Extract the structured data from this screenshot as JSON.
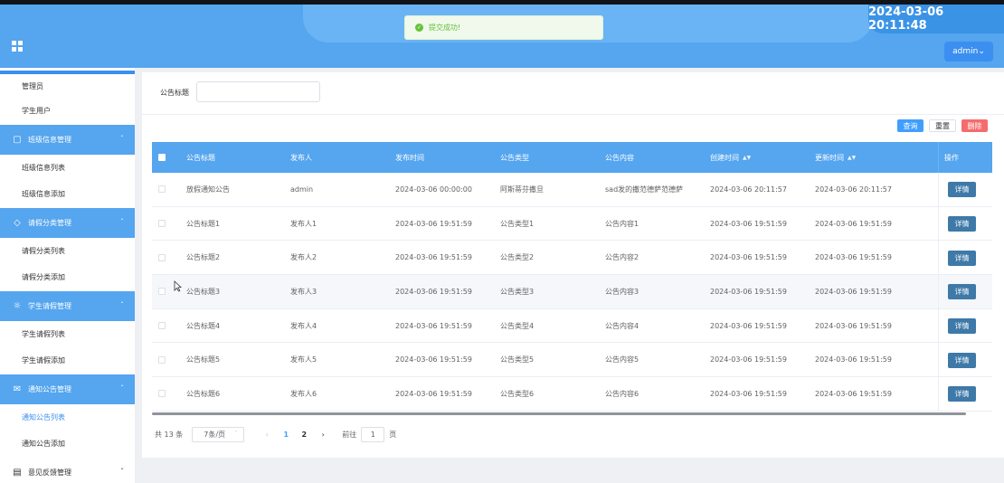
{
  "header": {
    "clock": "2024-03-06 20:11:48",
    "user_button": "admin⌄",
    "toast": "提交成功!"
  },
  "sidebar": {
    "top_items": [
      "管理员",
      "学生用户"
    ],
    "groups": [
      {
        "label": "班级信息管理",
        "icon": "bookmark-icon",
        "items": [
          "班级信息列表",
          "班级信息添加"
        ]
      },
      {
        "label": "请假分类管理",
        "icon": "tag-icon",
        "items": [
          "请假分类列表",
          "请假分类添加"
        ]
      },
      {
        "label": "学生请假管理",
        "icon": "gear-icon",
        "items": [
          "学生请假列表",
          "学生请假添加"
        ]
      },
      {
        "label": "通知公告管理",
        "icon": "mail-icon",
        "items": [
          "通知公告列表",
          "通知公告添加"
        ]
      }
    ],
    "collapsed_group": "意见反馈管理"
  },
  "search": {
    "label": "公告标题",
    "value": ""
  },
  "toolbar": {
    "query": "查询",
    "reset": "重置",
    "delete": "删除"
  },
  "table": {
    "headers": [
      "公告标题",
      "发布人",
      "发布时间",
      "公告类型",
      "公告内容",
      "创建时间",
      "更新时间",
      "操作"
    ],
    "rows": [
      [
        "放假通知公告",
        "admin",
        "2024-03-06 00:00:00",
        "阿斯蒂芬撒旦",
        "sad发的撒范德萨范德萨",
        "2024-03-06 20:11:57",
        "2024-03-06 20:11:57"
      ],
      [
        "公告标题1",
        "发布人1",
        "2024-03-06 19:51:59",
        "公告类型1",
        "公告内容1",
        "2024-03-06 19:51:59",
        "2024-03-06 19:51:59"
      ],
      [
        "公告标题2",
        "发布人2",
        "2024-03-06 19:51:59",
        "公告类型2",
        "公告内容2",
        "2024-03-06 19:51:59",
        "2024-03-06 19:51:59"
      ],
      [
        "公告标题3",
        "发布人3",
        "2024-03-06 19:51:59",
        "公告类型3",
        "公告内容3",
        "2024-03-06 19:51:59",
        "2024-03-06 19:51:59"
      ],
      [
        "公告标题4",
        "发布人4",
        "2024-03-06 19:51:59",
        "公告类型4",
        "公告内容4",
        "2024-03-06 19:51:59",
        "2024-03-06 19:51:59"
      ],
      [
        "公告标题5",
        "发布人5",
        "2024-03-06 19:51:59",
        "公告类型5",
        "公告内容5",
        "2024-03-06 19:51:59",
        "2024-03-06 19:51:59"
      ],
      [
        "公告标题6",
        "发布人6",
        "2024-03-06 19:51:59",
        "公告类型6",
        "公告内容6",
        "2024-03-06 19:51:59",
        "2024-03-06 19:51:59"
      ]
    ],
    "detail_label": "详情"
  },
  "pagination": {
    "total": "共 13 条",
    "page_size": "7条/页",
    "pages": [
      "1",
      "2"
    ],
    "current": "1",
    "goto_prefix": "前往",
    "goto_value": "1",
    "goto_suffix": "页"
  }
}
